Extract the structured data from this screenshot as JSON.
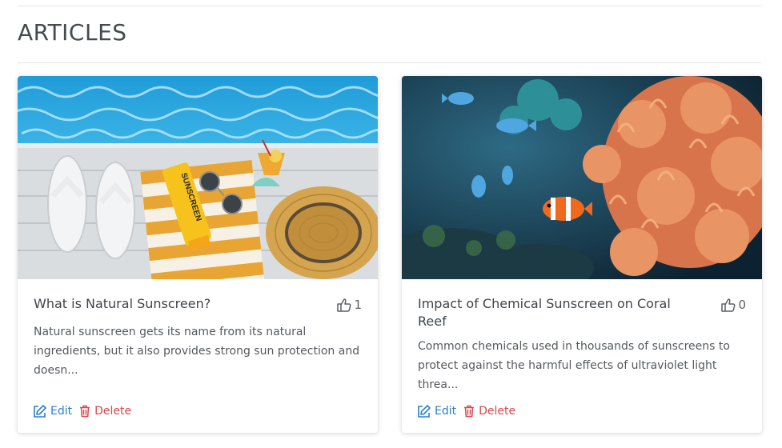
{
  "section": {
    "title": "ARTICLES"
  },
  "articles": [
    {
      "title": "What is Natural Sunscreen?",
      "likes": "1",
      "excerpt": "Natural sunscreen gets its name from its natural ingredients, but it also provides strong sun protection and doesn...",
      "edit_label": "Edit",
      "delete_label": "Delete",
      "image_subject": "sandals, sunscreen tube, towel and straw hat beside a pool",
      "image_text": "SUNSCREEN"
    },
    {
      "title": "Impact of Chemical Sunscreen on Coral Reef",
      "likes": "0",
      "excerpt": "Common chemicals used in thousands of sunscreens to protect against the harmful effects of ultraviolet light threa...",
      "edit_label": "Edit",
      "delete_label": "Delete",
      "image_subject": "clownfish and blue fish swimming by orange coral reef"
    }
  ],
  "icons": {
    "like": "thumbs-up-icon",
    "edit": "edit-icon",
    "delete": "trash-icon"
  },
  "colors": {
    "edit": "#2c7fc9",
    "delete": "#d8474a",
    "heading": "#454a50"
  }
}
